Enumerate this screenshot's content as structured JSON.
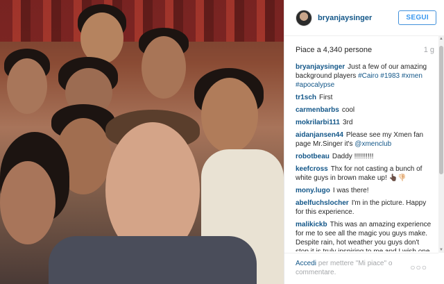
{
  "header": {
    "username": "bryanjaysinger",
    "follow_label": "SEGUI"
  },
  "meta": {
    "likes": "Piace a 4,340 persone",
    "time": "1 g"
  },
  "caption": {
    "author": "bryanjaysinger",
    "text": "Just a few of our amazing background players",
    "tags": "#Cairo #1983 #xmen #apocalypse"
  },
  "comments": [
    {
      "author": "tr1sch",
      "text": "First"
    },
    {
      "author": "carmenbarbs",
      "text": "cool"
    },
    {
      "author": "mokrilarbi111",
      "text": "3rd"
    },
    {
      "author": "aidanjansen44",
      "text": "Please see my Xmen fan page Mr.Singer it's",
      "link": "@xmenclub"
    },
    {
      "author": "robotbeau",
      "text": "Daddy !!!!!!!!!!"
    },
    {
      "author": "keefcross",
      "text": "Thx for not casting a bunch of white guys in brown make up! 👆🏿👎🏻"
    },
    {
      "author": "mony.lugo",
      "text": "I was there!"
    },
    {
      "author": "abelfuchslocher",
      "text": "I'm in the picture. Happy for this experience."
    },
    {
      "author": "malikickb",
      "text": "This was an amazing experience for me to see all the magic you guys make. Despite rain, hot weather you guys don't stop it is truly inspiring to me and I wish one day to"
    }
  ],
  "footer": {
    "login_text": "Accedi",
    "rest_text": "per mettere \"Mi piace\" o commentare.",
    "more": "○○○"
  }
}
